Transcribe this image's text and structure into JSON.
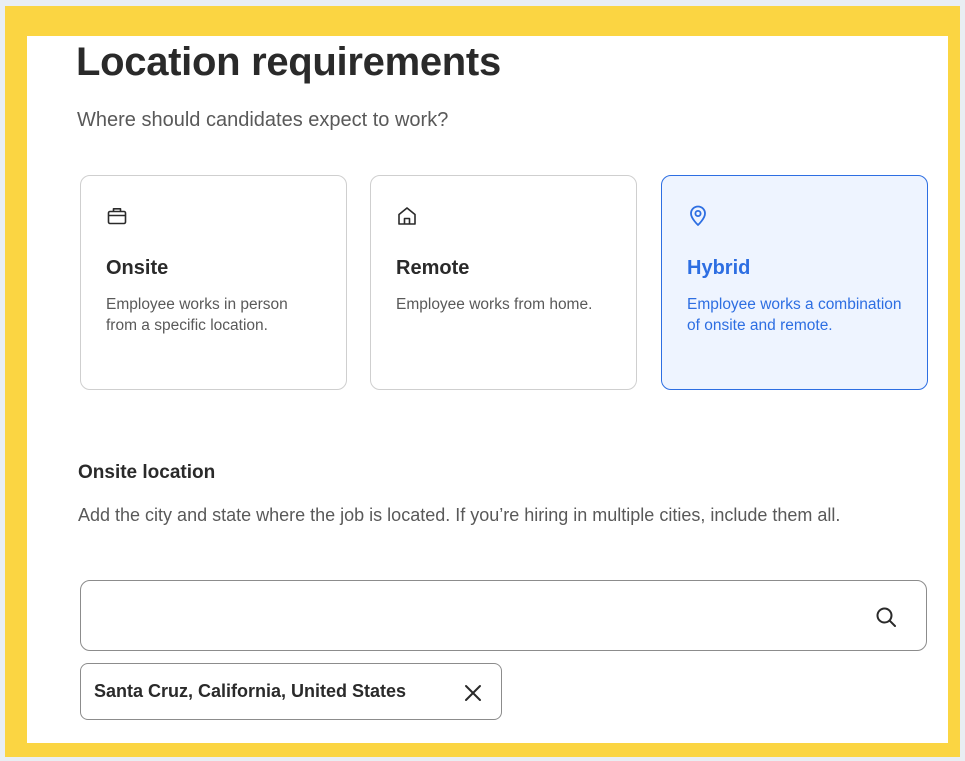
{
  "page": {
    "title": "Location requirements",
    "subtitle": "Where should candidates expect to work?"
  },
  "work_options": [
    {
      "icon": "briefcase-icon",
      "title": "Onsite",
      "description": "Employee works in person from a specific location.",
      "selected": false
    },
    {
      "icon": "home-icon",
      "title": "Remote",
      "description": "Employee works from home.",
      "selected": false
    },
    {
      "icon": "location-pin-icon",
      "title": "Hybrid",
      "description": "Employee works a combination of onsite and remote.",
      "selected": true
    }
  ],
  "onsite_location": {
    "title": "Onsite location",
    "description": "Add the city and state where the job is located. If you’re hiring in multiple cities, include them all.",
    "search_value": "",
    "search_icon": "search-icon",
    "chips": [
      {
        "label": "Santa Cruz, California, United States",
        "remove_icon": "close-icon"
      }
    ]
  },
  "colors": {
    "frame": "#fbd542",
    "selected_accent": "#2d6ee2",
    "selected_background": "#eef4ff",
    "text_primary": "#2a2a2a",
    "text_secondary": "#595959"
  }
}
